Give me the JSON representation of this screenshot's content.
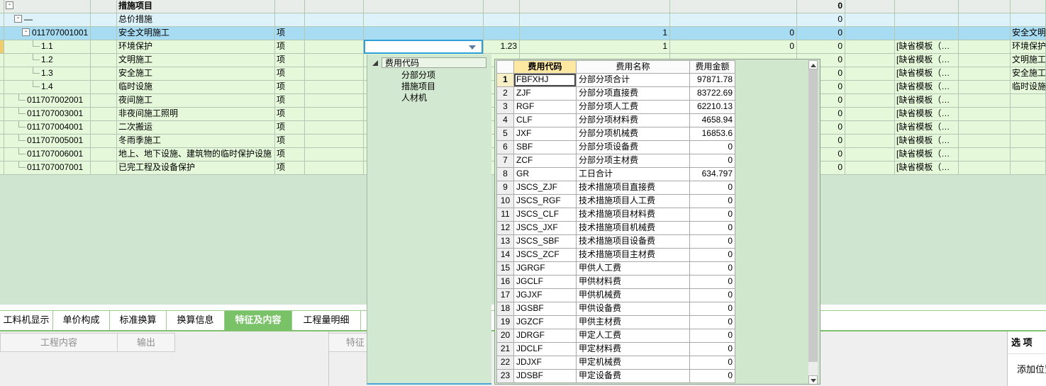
{
  "main_table": {
    "rows": [
      {
        "bg": "summary",
        "box": true,
        "indent": 2,
        "code": "",
        "name": "措施项目",
        "bold": true,
        "unit": "",
        "rate": "",
        "qty": "",
        "price": "",
        "total": "0",
        "template": "",
        "name2": ""
      },
      {
        "bg": "cyan",
        "box": true,
        "indent": 14,
        "code": "—",
        "name": "总价措施",
        "bold": false,
        "unit": "",
        "rate": "",
        "qty": "",
        "price": "",
        "total": "0",
        "template": "",
        "name2": ""
      },
      {
        "bg": "selected",
        "box": true,
        "indent": 25,
        "code": "011707001001",
        "name": "安全文明施工",
        "bold": false,
        "unit": "项",
        "rate": "",
        "qty": "1",
        "price": "0",
        "total": "0",
        "template": "",
        "name2": "安全文明施工"
      },
      {
        "bg": "green",
        "conn": true,
        "indent": 40,
        "marker": true,
        "code": "1.1",
        "name": "环境保护",
        "bold": false,
        "unit": "项",
        "rate": "1.23",
        "qty": "1",
        "price": "0",
        "total": "0",
        "template": "[缺省模板（…",
        "name2": "环境保护"
      },
      {
        "bg": "green",
        "conn": true,
        "indent": 40,
        "code": "1.2",
        "name": "文明施工",
        "bold": false,
        "unit": "项",
        "rate": "",
        "qty": "",
        "price": "",
        "total": "0",
        "template": "[缺省模板（…",
        "name2": "文明施工"
      },
      {
        "bg": "green",
        "conn": true,
        "indent": 40,
        "code": "1.3",
        "name": "安全施工",
        "bold": false,
        "unit": "项",
        "rate": "",
        "qty": "",
        "price": "",
        "total": "0",
        "template": "[缺省模板（…",
        "name2": "安全施工"
      },
      {
        "bg": "green",
        "conn": true,
        "indent": 40,
        "code": "1.4",
        "name": "临时设施",
        "bold": false,
        "unit": "项",
        "rate": "",
        "qty": "",
        "price": "",
        "total": "0",
        "template": "[缺省模板（…",
        "name2": "临时设施"
      },
      {
        "bg": "green",
        "conn": true,
        "indent": 20,
        "code": "011707002001",
        "name": "夜间施工",
        "bold": false,
        "unit": "项",
        "rate": "",
        "qty": "",
        "price": "",
        "total": "0",
        "template": "[缺省模板（…",
        "name2": ""
      },
      {
        "bg": "green",
        "conn": true,
        "indent": 20,
        "code": "011707003001",
        "name": "非夜间施工照明",
        "bold": false,
        "unit": "项",
        "rate": "",
        "qty": "",
        "price": "",
        "total": "0",
        "template": "[缺省模板（…",
        "name2": ""
      },
      {
        "bg": "green",
        "conn": true,
        "indent": 20,
        "code": "011707004001",
        "name": "二次搬运",
        "bold": false,
        "unit": "项",
        "rate": "",
        "qty": "",
        "price": "",
        "total": "0",
        "template": "[缺省模板（…",
        "name2": ""
      },
      {
        "bg": "green",
        "conn": true,
        "indent": 20,
        "code": "011707005001",
        "name": "冬雨季施工",
        "bold": false,
        "unit": "项",
        "rate": "",
        "qty": "",
        "price": "",
        "total": "0",
        "template": "[缺省模板（…",
        "name2": ""
      },
      {
        "bg": "green",
        "conn": true,
        "indent": 20,
        "code": "011707006001",
        "name": "地上、地下设施、建筑物的临时保护设施",
        "bold": false,
        "unit": "项",
        "rate": "",
        "qty": "",
        "price": "",
        "total": "0",
        "template": "[缺省模板（…",
        "name2": ""
      },
      {
        "bg": "green",
        "conn": true,
        "indent": 20,
        "code": "011707007001",
        "name": "已完工程及设备保护",
        "bold": false,
        "unit": "项",
        "rate": "",
        "qty": "",
        "price": "",
        "total": "0",
        "template": "[缺省模板（…",
        "name2": ""
      }
    ]
  },
  "combo": {
    "value": ""
  },
  "fee_tree": {
    "root": "费用代码",
    "children": [
      "分部分项",
      "措施项目",
      "人材机"
    ]
  },
  "fee_table": {
    "headers": {
      "code": "费用代码",
      "name": "费用名称",
      "amount": "费用金额"
    },
    "rows": [
      {
        "num": "1",
        "code": "FBFXHJ",
        "name": "分部分项合计",
        "amount": "97871.78"
      },
      {
        "num": "2",
        "code": "ZJF",
        "name": "分部分项直接费",
        "amount": "83722.69"
      },
      {
        "num": "3",
        "code": "RGF",
        "name": "分部分项人工费",
        "amount": "62210.13"
      },
      {
        "num": "4",
        "code": "CLF",
        "name": "分部分项材料费",
        "amount": "4658.94"
      },
      {
        "num": "5",
        "code": "JXF",
        "name": "分部分项机械费",
        "amount": "16853.6"
      },
      {
        "num": "6",
        "code": "SBF",
        "name": "分部分项设备费",
        "amount": "0"
      },
      {
        "num": "7",
        "code": "ZCF",
        "name": "分部分项主材费",
        "amount": "0"
      },
      {
        "num": "8",
        "code": "GR",
        "name": "工日合计",
        "amount": "634.797"
      },
      {
        "num": "9",
        "code": "JSCS_ZJF",
        "name": "技术措施项目直接费",
        "amount": "0"
      },
      {
        "num": "10",
        "code": "JSCS_RGF",
        "name": "技术措施项目人工费",
        "amount": "0"
      },
      {
        "num": "11",
        "code": "JSCS_CLF",
        "name": "技术措施项目材料费",
        "amount": "0"
      },
      {
        "num": "12",
        "code": "JSCS_JXF",
        "name": "技术措施项目机械费",
        "amount": "0"
      },
      {
        "num": "13",
        "code": "JSCS_SBF",
        "name": "技术措施项目设备费",
        "amount": "0"
      },
      {
        "num": "14",
        "code": "JSCS_ZCF",
        "name": "技术措施项目主材费",
        "amount": "0"
      },
      {
        "num": "15",
        "code": "JGRGF",
        "name": "甲供人工费",
        "amount": "0"
      },
      {
        "num": "16",
        "code": "JGCLF",
        "name": "甲供材料费",
        "amount": "0"
      },
      {
        "num": "17",
        "code": "JGJXF",
        "name": "甲供机械费",
        "amount": "0"
      },
      {
        "num": "18",
        "code": "JGSBF",
        "name": "甲供设备费",
        "amount": "0"
      },
      {
        "num": "19",
        "code": "JGZCF",
        "name": "甲供主材费",
        "amount": "0"
      },
      {
        "num": "20",
        "code": "JDRGF",
        "name": "甲定人工费",
        "amount": "0"
      },
      {
        "num": "21",
        "code": "JDCLF",
        "name": "甲定材料费",
        "amount": "0"
      },
      {
        "num": "22",
        "code": "JDJXF",
        "name": "甲定机械费",
        "amount": "0"
      },
      {
        "num": "23",
        "code": "JDSBF",
        "name": "甲定设备费",
        "amount": "0"
      }
    ]
  },
  "tabs": [
    {
      "label": "工料机显示",
      "active": false
    },
    {
      "label": "单价构成",
      "active": false
    },
    {
      "label": "标准换算",
      "active": false
    },
    {
      "label": "换算信息",
      "active": false
    },
    {
      "label": "特征及内容",
      "active": true
    },
    {
      "label": "工程量明细",
      "active": false
    }
  ],
  "bottom": {
    "left_header_1": "工程内容",
    "left_header_2": "输出",
    "mid_header": "特征",
    "options_title": "选 项",
    "options_item": "添加位置"
  },
  "colors": {
    "row_selected": "#a8dcf2",
    "row_normal": "#e5f8da",
    "row_group": "#def2f9",
    "empty_area": "#cfe5cf",
    "active_tab": "#79c267",
    "fee_code_header": "#ffe9a2",
    "combo_border": "#2da0d9",
    "row_marker": "#eecd6a"
  }
}
